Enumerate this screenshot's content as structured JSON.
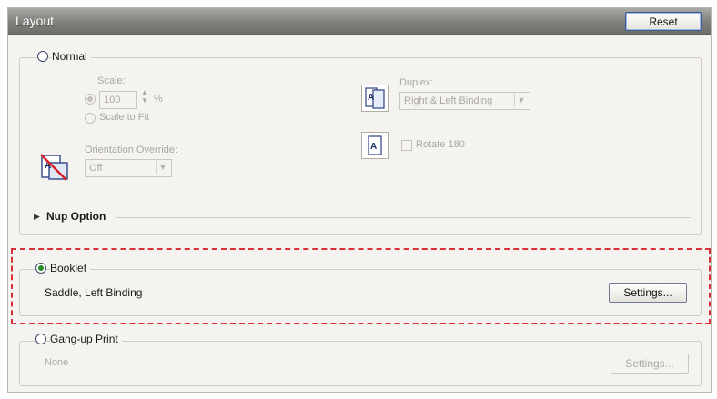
{
  "header": {
    "title": "Layout",
    "reset_label": "Reset"
  },
  "normal": {
    "radio_label": "Normal",
    "selected": false,
    "scale_label": "Scale:",
    "scale_value": "100",
    "scale_unit": "%",
    "scale_to_fit_label": "Scale to Fit",
    "orientation_label": "Orientation Override:",
    "orientation_value": "Off",
    "duplex_label": "Duplex:",
    "duplex_value": "Right & Left Binding",
    "rotate_label": "Rotate 180"
  },
  "nup": {
    "label": "Nup Option"
  },
  "booklet": {
    "radio_label": "Booklet",
    "selected": true,
    "binding_text": "Saddle, Left Binding",
    "settings_label": "Settings..."
  },
  "gangup": {
    "radio_label": "Gang-up Print",
    "selected": false,
    "value_text": "None",
    "settings_label": "Settings..."
  },
  "colors": {
    "highlight_dash": "#d8313a",
    "radio_selected": "#2a8c2a"
  }
}
